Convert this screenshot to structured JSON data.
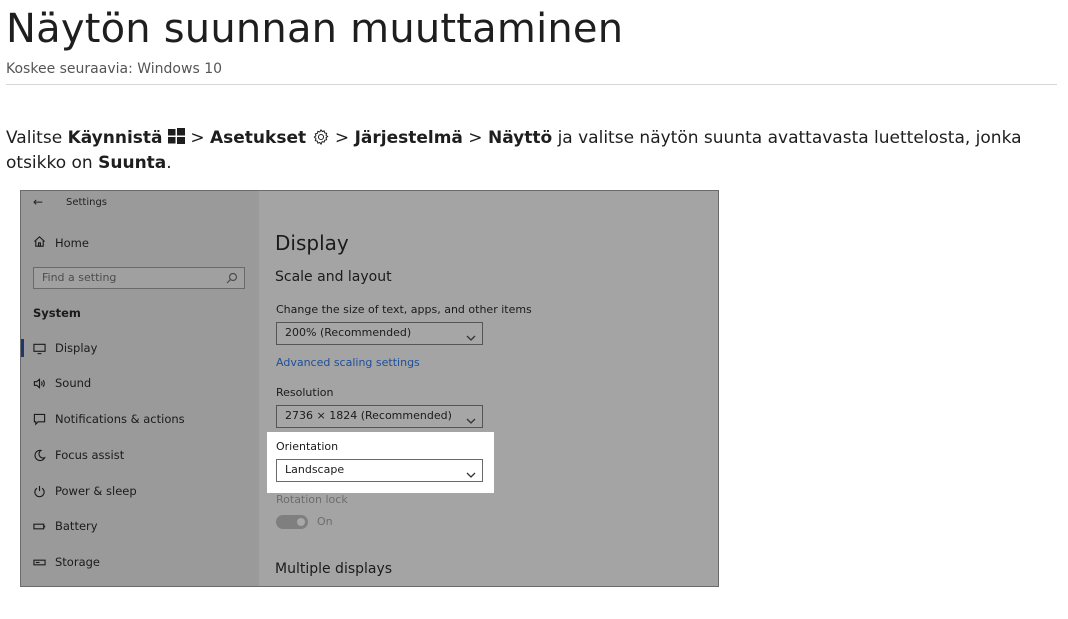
{
  "article": {
    "title": "Näytön suunnan muuttaminen",
    "applies_to": "Koskee seuraavia: Windows 10",
    "instruction": {
      "t1": "Valitse ",
      "start": "Käynnistä",
      "sep1": " > ",
      "settings": "Asetukset",
      "sep2": " > ",
      "system": "Järjestelmä",
      "sep3": " > ",
      "display": "Näyttö",
      "t2": " ja valitse näytön suunta avattavasta luettelosta, jonka otsikko on ",
      "orientation": "Suunta",
      "t3": "."
    }
  },
  "screenshot": {
    "window_title": "Settings",
    "back_glyph": "←",
    "sidebar": {
      "home": "Home",
      "search_placeholder": "Find a setting",
      "section": "System",
      "items": [
        {
          "label": "Display",
          "icon": "monitor-icon"
        },
        {
          "label": "Sound",
          "icon": "speaker-icon"
        },
        {
          "label": "Notifications & actions",
          "icon": "notification-icon"
        },
        {
          "label": "Focus assist",
          "icon": "moon-icon"
        },
        {
          "label": "Power & sleep",
          "icon": "power-icon"
        },
        {
          "label": "Battery",
          "icon": "battery-icon"
        },
        {
          "label": "Storage",
          "icon": "storage-icon"
        }
      ]
    },
    "main": {
      "heading": "Display",
      "section": "Scale and layout",
      "scale_label": "Change the size of text, apps, and other items",
      "scale_value": "200% (Recommended)",
      "advanced_link": "Advanced scaling settings",
      "resolution_label": "Resolution",
      "resolution_value": "2736 × 1824 (Recommended)",
      "orientation_label": "Orientation",
      "orientation_value": "Landscape",
      "rotation_lock_label": "Rotation lock",
      "rotation_lock_state": "On",
      "multiple_displays": "Multiple displays"
    }
  },
  "colors": {
    "link": "#1d4f9a",
    "highlight": "#ffffff",
    "overlay": "#a4a4a4"
  }
}
